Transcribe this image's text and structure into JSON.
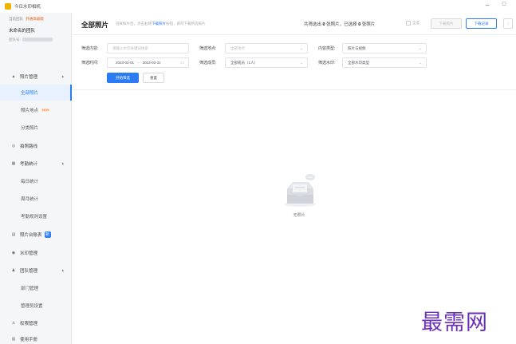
{
  "window": {
    "title": "今日水印相机",
    "minimize": "–",
    "maximize": "□"
  },
  "sidebar": {
    "team_top_label": "当前团队",
    "vip_label": "开通高级版",
    "team_name": "未命名的团队",
    "team_no_label": "团队号:",
    "items": [
      {
        "label": "照片管理",
        "icon": "image-icon",
        "type": "group",
        "expanded": true
      },
      {
        "label": "全部照片",
        "type": "sub",
        "active": true
      },
      {
        "label": "照片地点",
        "type": "sub",
        "badge": "NEW"
      },
      {
        "label": "分类照片",
        "type": "sub"
      },
      {
        "label": "拍照路线",
        "icon": "route-icon",
        "type": "group"
      },
      {
        "label": "考勤统计",
        "icon": "calendar-icon",
        "type": "group",
        "expanded": true
      },
      {
        "label": "每日统计",
        "type": "sub"
      },
      {
        "label": "周月统计",
        "type": "sub"
      },
      {
        "label": "考勤规则设置",
        "type": "sub"
      },
      {
        "label": "照片台账表",
        "icon": "table-icon",
        "type": "group",
        "badge": "新"
      },
      {
        "label": "水印管理",
        "icon": "watermark-icon",
        "type": "group"
      },
      {
        "label": "团队管理",
        "icon": "team-icon",
        "type": "group",
        "expanded": true
      },
      {
        "label": "部门管理",
        "type": "sub"
      },
      {
        "label": "管理员设置",
        "type": "sub"
      },
      {
        "label": "权限管理",
        "icon": "lock-icon",
        "type": "group"
      },
      {
        "label": "使用手册",
        "icon": "book-icon",
        "type": "group"
      }
    ]
  },
  "header": {
    "title": "全部照片",
    "hint_pre": "选择照片后，点击右侧",
    "hint_link": "下载照片",
    "hint_post": "按钮，即可下载所选照片",
    "stats_pre": "共筛选出",
    "count_total": "0",
    "stats_mid": "张照片，已选择",
    "count_selected": "0",
    "stats_post": "张照片",
    "select_all": "全选",
    "download_photos": "下载照片",
    "download_records": "下载记录",
    "more": "⋮"
  },
  "filters": {
    "content_label": "筛选内容:",
    "content_placeholder": "请输入水印关键词搜索",
    "location_label": "筛选地点:",
    "location_placeholder": "全部地点",
    "type_label": "内容类型:",
    "type_value": "照片与视频",
    "time_label": "筛选时间:",
    "date_start": "2023-03-01",
    "date_sep": "~",
    "date_end": "2023-03-31",
    "member_label": "筛选成员:",
    "member_value": "全部成员（1人）",
    "watermark_label": "筛选水印:",
    "watermark_value": "全部水印类型",
    "start_button": "开始筛选",
    "reset_button": "重置"
  },
  "empty_state": {
    "text": "无照片"
  },
  "watermark_text": "最需网",
  "colors": {
    "accent": "#2a7bf4",
    "sidebar_bg": "#f5f6f8",
    "watermark": "#6a2fb8"
  }
}
